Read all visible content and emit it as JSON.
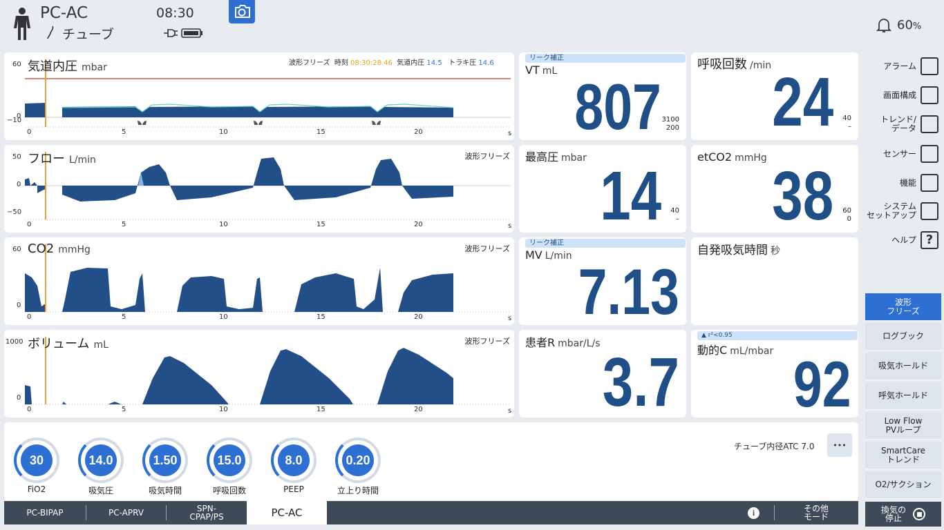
{
  "header": {
    "mode": "PC-AC",
    "tube": "チューブ",
    "time": "08:30",
    "bell_value": "60",
    "bell_unit": "%"
  },
  "waveforms": [
    {
      "title": "気道内圧",
      "unit": "mbar",
      "ymax": "60",
      "yzero": "0",
      "ymin": "−10",
      "freeze_label": "波形フリーズ",
      "time_label": "時刻",
      "time_value": "08:30:28.46",
      "paw_label": "気道内圧",
      "paw_value": "14.5",
      "trach_label": "トラキ圧",
      "trach_value": "14.6"
    },
    {
      "title": "フロー",
      "unit": "L/min",
      "ymax": "50",
      "yzero": "0",
      "ymin": "−50",
      "freeze_label": "波形フリーズ"
    },
    {
      "title": "CO2",
      "unit": "mmHg",
      "ymax": "60",
      "yzero": "0",
      "freeze_label": "波形フリーズ"
    },
    {
      "title": "ボリューム",
      "unit": "mL",
      "ymax": "1000",
      "yzero": "0",
      "freeze_label": "波形フリーズ"
    }
  ],
  "xaxis": {
    "ticks": [
      "0",
      "5",
      "10",
      "15",
      "20"
    ],
    "unit": "s"
  },
  "values": {
    "vt": {
      "leak": "リーク補正",
      "label": "VT",
      "unit": "mL",
      "value": "807",
      "hi": "3100",
      "lo": "200"
    },
    "rr": {
      "label": "呼吸回数",
      "unit": "/min",
      "value": "24",
      "hi": "40",
      "lo": "–"
    },
    "pmax": {
      "label": "最高圧",
      "unit": "mbar",
      "value": "14",
      "hi": "40",
      "lo": "–"
    },
    "etco2": {
      "label": "etCO2",
      "unit": "mmHg",
      "value": "38",
      "hi": "60",
      "lo": "0"
    },
    "mv": {
      "leak": "リーク補正",
      "label": "MV",
      "unit": "L/min",
      "value": "7.13"
    },
    "ti_spont": {
      "label": "自発吸気時間",
      "unit": "秒"
    },
    "rpat": {
      "label": "患者R",
      "unit": "mbar/L/s",
      "value": "3.7"
    },
    "cdyn": {
      "warn": "r²<0.95",
      "label": "動的C",
      "unit": "mL/mbar",
      "value": "92"
    }
  },
  "menu": [
    {
      "label": "アラーム",
      "icon": "alarm-icon"
    },
    {
      "label": "画面構成",
      "icon": "layout-icon"
    },
    {
      "label": "トレンド/\nデータ",
      "icon": "trend-icon"
    },
    {
      "label": "センサー",
      "icon": "sensor-icon"
    },
    {
      "label": "機能",
      "icon": "function-icon"
    },
    {
      "label": "システム\nセットアップ",
      "icon": "system-icon"
    },
    {
      "label": "ヘルプ",
      "icon": "help-icon"
    }
  ],
  "side_buttons": [
    {
      "label": "波形\nフリーズ",
      "active": true
    },
    {
      "label": "ログブック"
    },
    {
      "label": "吸気ホールド"
    },
    {
      "label": "呼気ホールド"
    },
    {
      "label": "Low Flow\nPVループ"
    },
    {
      "label": "SmartCare\nトレンド"
    },
    {
      "label": "O2/サクション"
    }
  ],
  "stop_button": "換気の\n停止",
  "settings": {
    "tube_atc": "チューブ内径ATC 7.0",
    "more": "•••",
    "knobs": [
      {
        "value": "30",
        "label": "FiO2"
      },
      {
        "value": "14.0",
        "label": "吸気圧"
      },
      {
        "value": "1.50",
        "label": "吸気時間"
      },
      {
        "value": "15.0",
        "label": "呼吸回数"
      },
      {
        "value": "8.0",
        "label": "PEEP"
      },
      {
        "value": "0.20",
        "label": "立上り時間"
      }
    ]
  },
  "modes": {
    "tabs": [
      "PC-BIPAP",
      "PC-APRV",
      "SPN-\nCPAP/PS",
      "PC-AC"
    ],
    "active": "PC-AC",
    "other": "その他\nモード"
  },
  "colors": {
    "wave": "#234f88",
    "accent": "#2d6fd2",
    "cursor": "#f0a030",
    "limit": "#c0392b",
    "modebar": "#3e4a58"
  }
}
